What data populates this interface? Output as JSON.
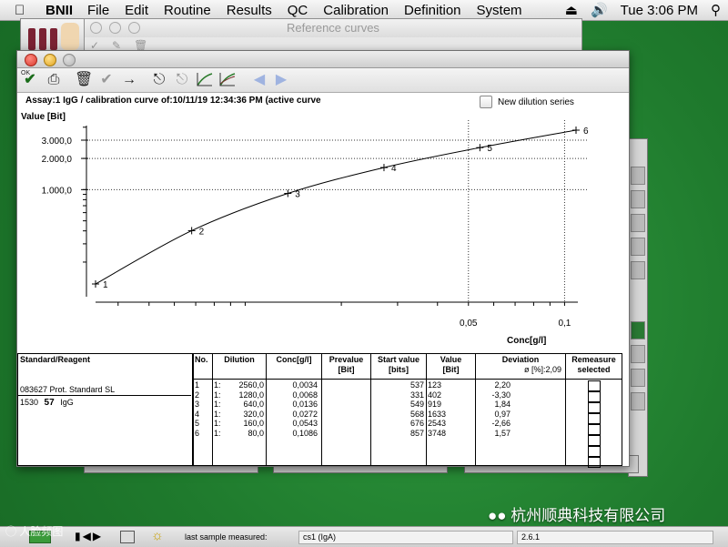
{
  "menubar": {
    "app": "BNII",
    "items": [
      "File",
      "Edit",
      "Routine",
      "Results",
      "QC",
      "Calibration",
      "Definition",
      "System"
    ],
    "clock": "Tue 3:06 PM"
  },
  "bg_window": {
    "title": "Reference curves"
  },
  "window": {
    "assay_title": "Assay:1 IgG / calibration curve of:10/11/19 12:34:36 PM  (active curve",
    "new_dilution_label": "New dilution series",
    "toolbar_ok": "OK"
  },
  "chart_data": {
    "type": "line",
    "ylabel": "Value [Bit]",
    "xlabel": "Conc[g/l]",
    "x_scale": "log",
    "y_scale": "log",
    "y_ticks": [
      "3.000,0",
      "2.000,0",
      "1.000,0"
    ],
    "x_ticks": [
      "0,05",
      "0,1"
    ],
    "grid": "dotted",
    "series": [
      {
        "points": [
          {
            "label": "1",
            "x": 0.0034,
            "y": 123
          },
          {
            "label": "2",
            "x": 0.0068,
            "y": 402
          },
          {
            "label": "3",
            "x": 0.0136,
            "y": 919
          },
          {
            "label": "4",
            "x": 0.0272,
            "y": 1633
          },
          {
            "label": "5",
            "x": 0.0543,
            "y": 2543
          },
          {
            "label": "6",
            "x": 0.1086,
            "y": 3748
          }
        ]
      }
    ]
  },
  "table": {
    "headers": {
      "standard": "Standard/Reagent",
      "no": "No.",
      "dilution": "Dilution",
      "conc": "Conc[g/l]",
      "prevalue": "Prevalue\n[Bit]",
      "start": "Start value\n[bits]",
      "value": "Value\n[Bit]",
      "deviation": "Deviation",
      "deviation_sub": "ø [%]:2,09",
      "remeasure": "Remeasure\nselected"
    },
    "standard_name": "083627 Prot. Standard SL",
    "standard_line2_a": "1530",
    "standard_line2_b": "57",
    "standard_line2_c": "IgG",
    "rows": [
      {
        "no": "1",
        "dil_a": "1:",
        "dil_b": "2560,0",
        "conc": "0,0034",
        "prevalue": "",
        "start": "537",
        "value": "123",
        "deviation": "2,20"
      },
      {
        "no": "2",
        "dil_a": "1:",
        "dil_b": "1280,0",
        "conc": "0,0068",
        "prevalue": "",
        "start": "331",
        "value": "402",
        "deviation": "-3,30"
      },
      {
        "no": "3",
        "dil_a": "1:",
        "dil_b": "640,0",
        "conc": "0,0136",
        "prevalue": "",
        "start": "549",
        "value": "919",
        "deviation": "1,84"
      },
      {
        "no": "4",
        "dil_a": "1:",
        "dil_b": "320,0",
        "conc": "0,0272",
        "prevalue": "",
        "start": "568",
        "value": "1633",
        "deviation": "0,97"
      },
      {
        "no": "5",
        "dil_a": "1:",
        "dil_b": "160,0",
        "conc": "0,0543",
        "prevalue": "",
        "start": "676",
        "value": "2543",
        "deviation": "-2,66"
      },
      {
        "no": "6",
        "dil_a": "1:",
        "dil_b": "80,0",
        "conc": "0,1086",
        "prevalue": "",
        "start": "857",
        "value": "3748",
        "deviation": "1,57"
      }
    ]
  },
  "statusbar": {
    "last_sample_label": "last sample measured:",
    "last_sample_value": "cs1 (IgA)",
    "version": "2.6.1"
  },
  "watermark": "杭州顺典科技有限公司",
  "watermark2": "人脸频图"
}
